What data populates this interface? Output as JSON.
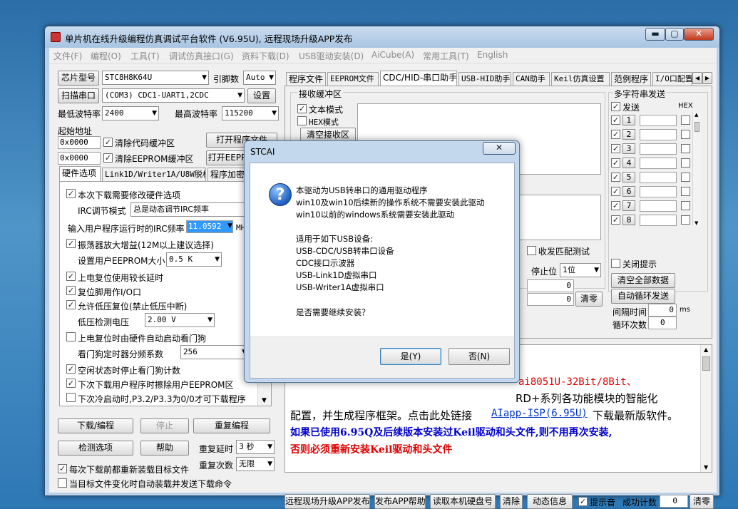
{
  "window": {
    "title": "单片机在线升级编程仿真调试平台软件 (V6.95U), 远程现场升级APP发布",
    "btn_min": "▬",
    "btn_max": "▢",
    "btn_close": "✕"
  },
  "menu": [
    "文件(F)",
    "编程(O)",
    "工具(T)",
    "调试仿真接口(G)",
    "资料下载(D)",
    "USB驱动安装(D)",
    "AiCube(A)",
    "常用工具(T)",
    "English"
  ],
  "left": {
    "chip_btn": "芯片型号",
    "chip_value": "STC8H8K64U",
    "pins_label": "引脚数",
    "pins_value": "Auto",
    "scan_btn": "扫描串口",
    "port_value": "(COM3) CDC1-UART1,2CDC",
    "settings_btn": "设置",
    "min_baud_label": "最低波特率",
    "min_baud": "2400",
    "max_baud_label": "最高波特率",
    "max_baud": "115200",
    "start_addr_label": "起始地址",
    "addr1": "0x0000",
    "clear_code": "清除代码缓冲区",
    "open_prog": "打开程序文件",
    "addr2": "0x0000",
    "clear_eeprom": "清除EEPROM缓冲区",
    "open_eeprom": "打开EEPR",
    "tabs": [
      "硬件选项",
      "Link1D/Writer1A/U8W脱机",
      "程序加密"
    ],
    "options": [
      {
        "label": "本次下载需要修改硬件选项",
        "checked": "✓"
      },
      {
        "label": "IRC调节模式",
        "value": "总是动态调节IRC频率"
      },
      {
        "label": "输入用户程序运行时的IRC频率",
        "value": "11.0592",
        "unit": "MH"
      },
      {
        "label": "振荡器放大增益(12M以上建议选择)",
        "checked": "✓"
      },
      {
        "label": "设置用户EEPROM大小",
        "value": "0.5 K"
      },
      {
        "label": "上电复位使用较长延时",
        "checked": "✓"
      },
      {
        "label": "复位脚用作I/O口",
        "checked": "✓"
      },
      {
        "label": "允许低压复位(禁止低压中断)",
        "checked": "✓"
      },
      {
        "label": "低压检测电压",
        "value": "2.00 V"
      },
      {
        "label": "上电复位时由硬件自动启动看门狗",
        "checked": ""
      },
      {
        "label": "看门狗定时器分频系数",
        "value": "256"
      },
      {
        "label": "空闲状态时停止看门狗计数",
        "checked": "✓"
      },
      {
        "label": "下次下载用户程序时擦除用户EEPROM区",
        "checked": "✓"
      },
      {
        "label": "下次冷启动时,P3.2/P3.3为0/0才可下载程序",
        "checked": ""
      }
    ],
    "download_btn": "下载/编程",
    "stop_btn": "停止",
    "reprog_btn": "重复编程",
    "check_btn": "检测选项",
    "help_btn": "帮助",
    "repeat_delay_label": "重复延时",
    "repeat_delay": "3 秒",
    "repeat_count_label": "重复次数",
    "repeat_count": "无限",
    "reload_label": "每次下载前都重新装载目标文件",
    "reload_checked": "✓",
    "auto_label": "当目标文件变化时自动装载并发送下载命令"
  },
  "right": {
    "tabs": [
      "程序文件",
      "EEPROM文件",
      "CDC/HID-串口助手",
      "USB-HID助手",
      "CAN助手",
      "Keil仿真设置",
      "范例程序",
      "I/O口配置"
    ],
    "recv_title": "接收缓冲区",
    "text_mode": "文本模式",
    "hex_mode": "HEX模式",
    "clear_recv": "清空接收区",
    "multi_title": "多字符串发送",
    "send_label": "发送",
    "hex_label": "HEX",
    "send_nums": [
      "1",
      "2",
      "3",
      "4",
      "5",
      "6",
      "7",
      "8"
    ],
    "close_tip": "关闭提示",
    "clear_all": "清空全部数据",
    "auto_loop": "自动循环发送",
    "interval_label": "间隔时间",
    "interval_value": "0",
    "interval_unit": "ms",
    "loop_label": "循环次数",
    "loop_value": "0",
    "match_test": "收发匹配测试",
    "stop_bit_label": "停止位",
    "stop_bit": "1位",
    "count1": "0",
    "count2": "0",
    "clear_small": "清零",
    "info_line1a": "ai8051U-32Bit/8Bit、",
    "info_line2a": "RD+系列各功能模块的智能化",
    "info_line3": "配置，并生成程序框架。点击此处链接",
    "info_link": "AIapp-ISP(6.95U)",
    "info_line3b": "下载最新版软件。",
    "info_line4": "如果已使用6.95Q及后续版本安装过Keil驱动和头文件,则不用再次安装,",
    "info_line5": "否则必须重新安装Keil驱动和头文件"
  },
  "bottom": {
    "remote_btn": "远程现场升级APP发布",
    "publish_help": "发布APP帮助",
    "read_disk": "读取本机硬盘号",
    "clear_btn": "清除",
    "dynamic_btn": "动态信息",
    "beep_label": "提示音",
    "success_label": "成功计数",
    "success_value": "0",
    "zero_btn": "清零"
  },
  "dialog": {
    "title": "STCAI",
    "close": "✕",
    "icon": "?",
    "lines": [
      "本驱动为USB转串口的通用驱动程序",
      "win10及win10后续新的操作系统不需要安装此驱动",
      "win10以前的windows系统需要安装此驱动"
    ],
    "devices_title": "适用于如下USB设备:",
    "devices": [
      "USB-CDC/USB转串口设备",
      "CDC接口示波器",
      "USB-Link1D虚拟串口",
      "USB-Writer1A虚拟串口"
    ],
    "question": "是否需要继续安装？",
    "yes": "是(Y)",
    "no": "否(N)"
  },
  "colors": {
    "link": "#0033cc",
    "blue_text": "#0000cc",
    "red_text": "#e00000",
    "dialog_frame": "#c3d8ec",
    "window_frame": "#b8d0e8"
  }
}
